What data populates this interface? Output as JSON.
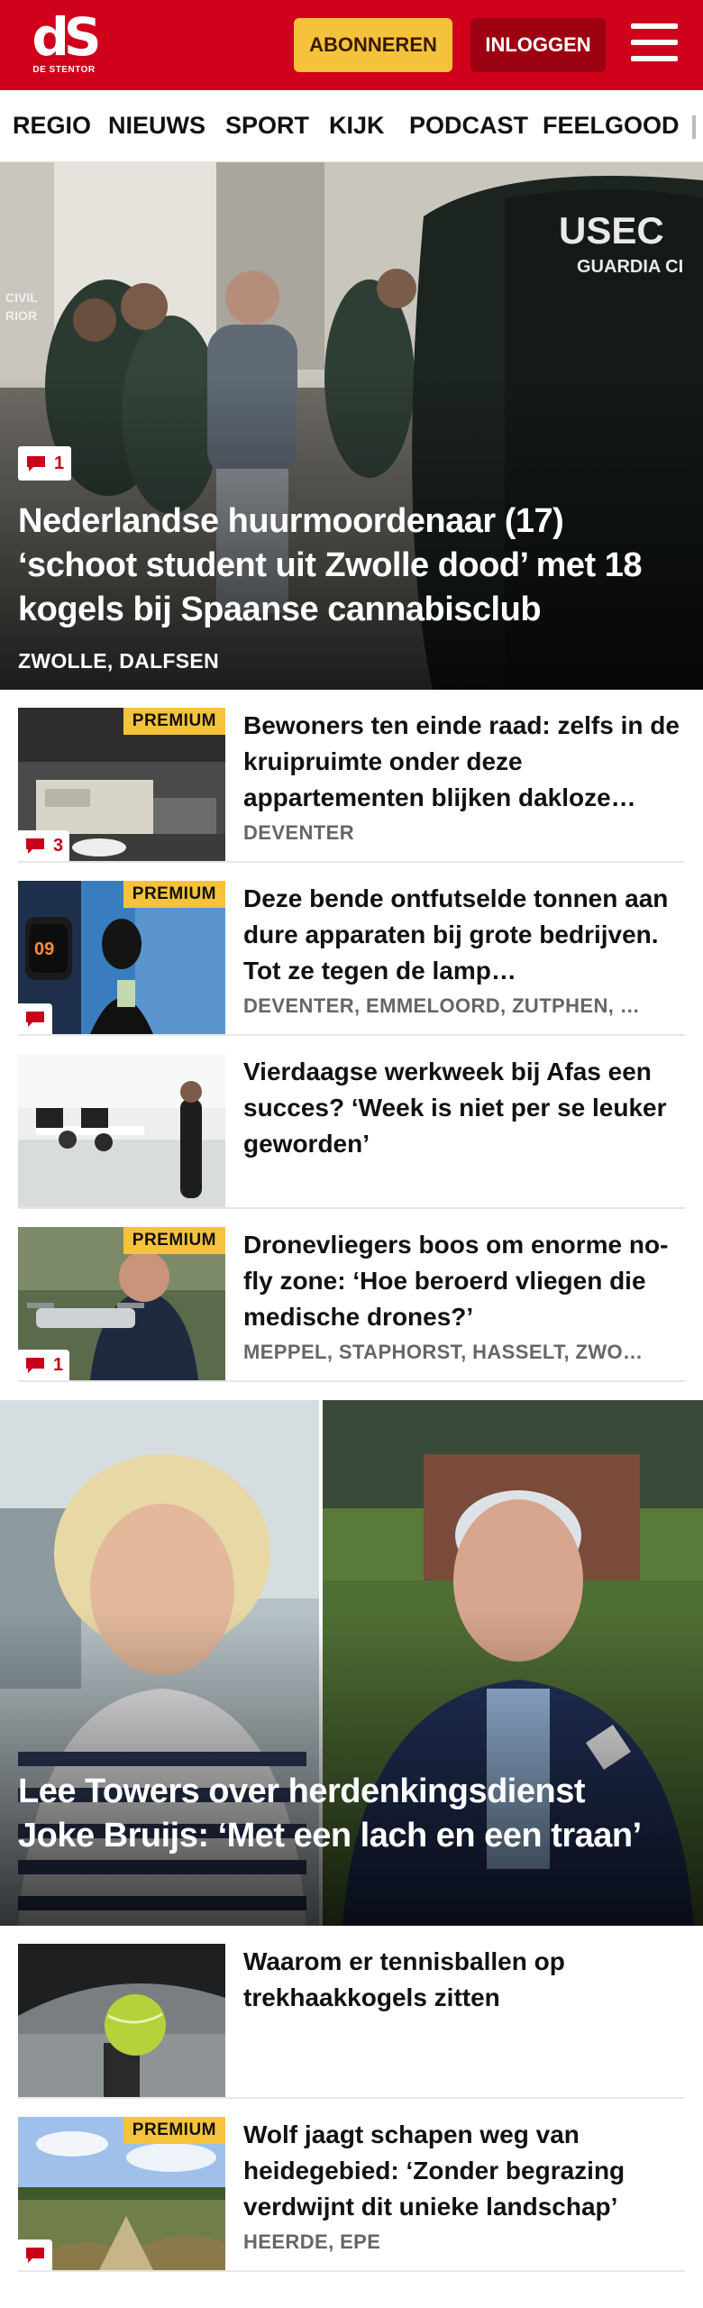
{
  "header": {
    "logo_mark": "dS",
    "logo_sub": "DE STENTOR",
    "subscribe_label": "ABONNEREN",
    "login_label": "INLOGGEN",
    "menu_icon": "hamburger-icon",
    "brand_color": "#d0011b"
  },
  "nav": {
    "items": [
      "REGIO",
      "NIEUWS",
      "SPORT",
      "KIJK",
      "PODCAST",
      "FEELGOOD"
    ]
  },
  "hero1": {
    "comments": "1",
    "title": "Nederlandse huurmoordenaar (17) ‘schoot student uit Zwolle dood’ met 18 kogels bij Spaanse cannabisclub",
    "tags": "ZWOLLE, DALFSEN",
    "vest_text_1": "USEC",
    "vest_text_2": "GUARDIA CI",
    "wall_text": "CIVIL\nRIOR"
  },
  "articles": [
    {
      "title": "Bewoners ten einde raad: zelfs in de kruipruimte onder deze appartementen blijken dakloze…",
      "tags": "DEVENTER",
      "premium": "PREMIUM",
      "comments": "3"
    },
    {
      "title": "Deze bende ontfutselde tonnen aan dure apparaten bij grote bedrijven. Tot ze tegen de lamp…",
      "tags": "DEVENTER, EMMELOORD, ZUTPHEN, …",
      "premium": "PREMIUM",
      "comments": "",
      "watch_text": "09"
    },
    {
      "title": "Vierdaagse werkweek bij Afas een succes? ‘Week is niet per se leuker geworden’",
      "tags": "",
      "premium": "",
      "comments": ""
    },
    {
      "title": "Dronevliegers boos om enorme no-fly zone: ‘Hoe beroerd vliegen die medische drones?’",
      "tags": "MEPPEL, STAPHORST, HASSELT, ZWO…",
      "premium": "PREMIUM",
      "comments": "1"
    }
  ],
  "hero2": {
    "title": "Lee Towers over herdenkingsdienst Joke Bruijs: ‘Met een lach en een traan’"
  },
  "articles2": [
    {
      "title": "Waarom er tennisballen op trekhaakkogels zitten",
      "tags": "",
      "premium": "",
      "comments": ""
    },
    {
      "title": "Wolf jaagt schapen weg van heidegebied: ‘Zonder begrazing verdwijnt dit unieke landschap’",
      "tags": "HEERDE, EPE",
      "premium": "PREMIUM",
      "comments": ""
    }
  ],
  "colors": {
    "accent_red": "#d0011b",
    "premium_yellow": "#f5c33b",
    "comment_red": "#c8001a"
  }
}
